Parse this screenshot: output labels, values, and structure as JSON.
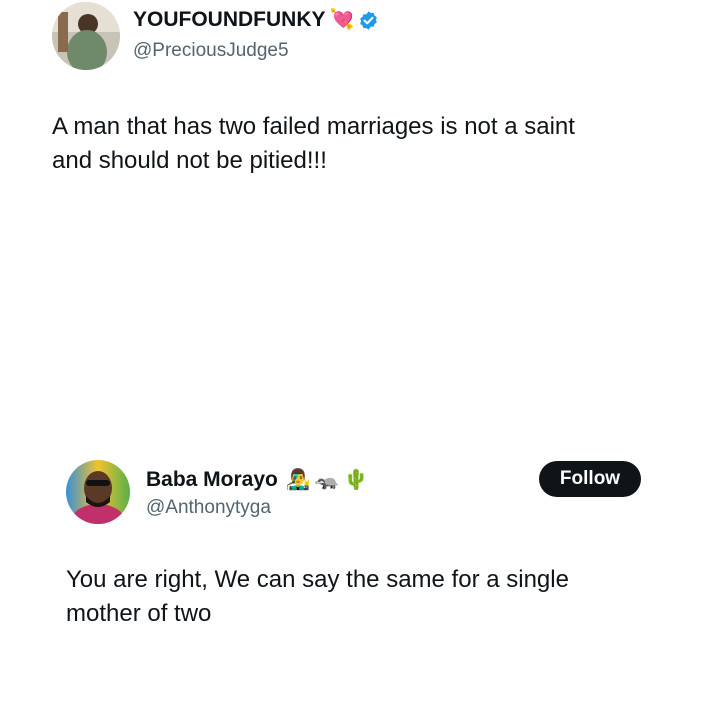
{
  "tweet": {
    "author_name": "YOUFOUNDFUNKY",
    "author_handle": "@PreciousJudge5",
    "name_emoji": "💘",
    "verified_badge": "verified-badge-icon",
    "text_line1": "A man that has two failed marriages is not a saint",
    "text_line2": "and should not be pitied!!!"
  },
  "reply": {
    "author_name": "Baba Morayo",
    "author_handle": "@Anthonytyga",
    "name_emojis": [
      "👨‍🎤",
      "🦡",
      "🌵"
    ],
    "follow_label": "Follow",
    "text_line1": "You are right, We can say the same for a single",
    "text_line2": "mother of two"
  },
  "colors": {
    "primary_text": "#0f1419",
    "secondary_text": "#536471",
    "verified_blue": "#1d9bf0",
    "follow_bg": "#0f1419"
  }
}
